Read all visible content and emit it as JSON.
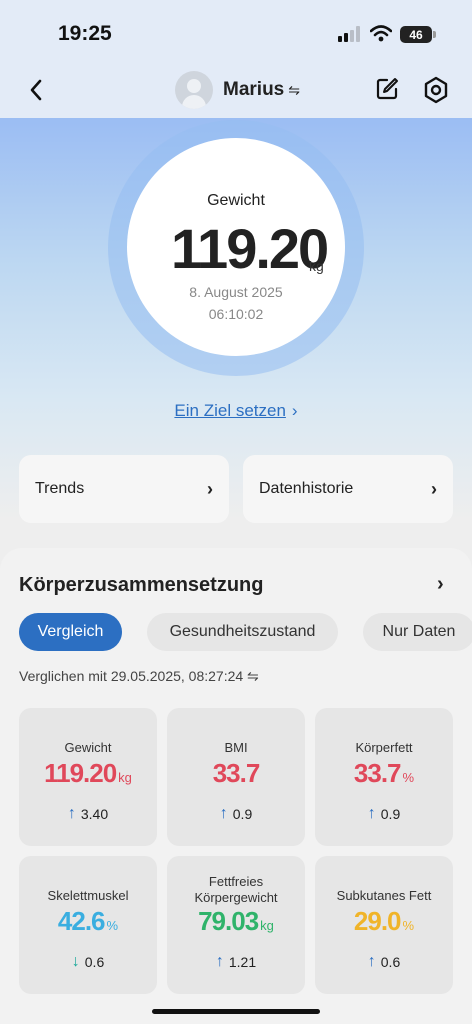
{
  "status_bar": {
    "time": "19:25",
    "battery": "46"
  },
  "nav": {
    "user_name": "Marius",
    "swap_symbol": "⇋"
  },
  "gauge": {
    "label": "Gewicht",
    "value": "119.20",
    "unit": "kg",
    "date": "8. August 2025",
    "time": "06:10:02"
  },
  "goal_link": {
    "label": "Ein Ziel setzen",
    "chevron": "›"
  },
  "cards": {
    "trends": "Trends",
    "history": "Datenhistorie"
  },
  "section": {
    "title": "Körperzusammensetzung",
    "tabs": [
      {
        "label": "Vergleich",
        "active": true
      },
      {
        "label": "Gesundheitszustand",
        "active": false
      },
      {
        "label": "Nur Daten",
        "active": false
      }
    ],
    "compare_text": "Verglichen mit 29.05.2025, 08:27:24 ⇋"
  },
  "metrics": [
    {
      "label": "Gewicht",
      "value": "119.20",
      "unit": "kg",
      "change": "3.40",
      "direction": "up",
      "color": "#e0485a"
    },
    {
      "label": "BMI",
      "value": "33.7",
      "unit": "",
      "change": "0.9",
      "direction": "up",
      "color": "#e0485a"
    },
    {
      "label": "Körperfett",
      "value": "33.7",
      "unit": "%",
      "change": "0.9",
      "direction": "up",
      "color": "#e0485a"
    },
    {
      "label": "Skelettmuskel",
      "value": "42.6",
      "unit": "%",
      "change": "0.6",
      "direction": "down",
      "color": "#3aaee0"
    },
    {
      "label": "Fettfreies Körpergewicht",
      "value": "79.03",
      "unit": "kg",
      "change": "1.21",
      "direction": "up",
      "color": "#2fb36a"
    },
    {
      "label": "Subkutanes Fett",
      "value": "29.0",
      "unit": "%",
      "change": "0.6",
      "direction": "up",
      "color": "#f0b429"
    }
  ],
  "colors": {
    "accent": "#2c6fc2",
    "arrow_up": "#2c6fc2",
    "arrow_down": "#1aa89a"
  }
}
